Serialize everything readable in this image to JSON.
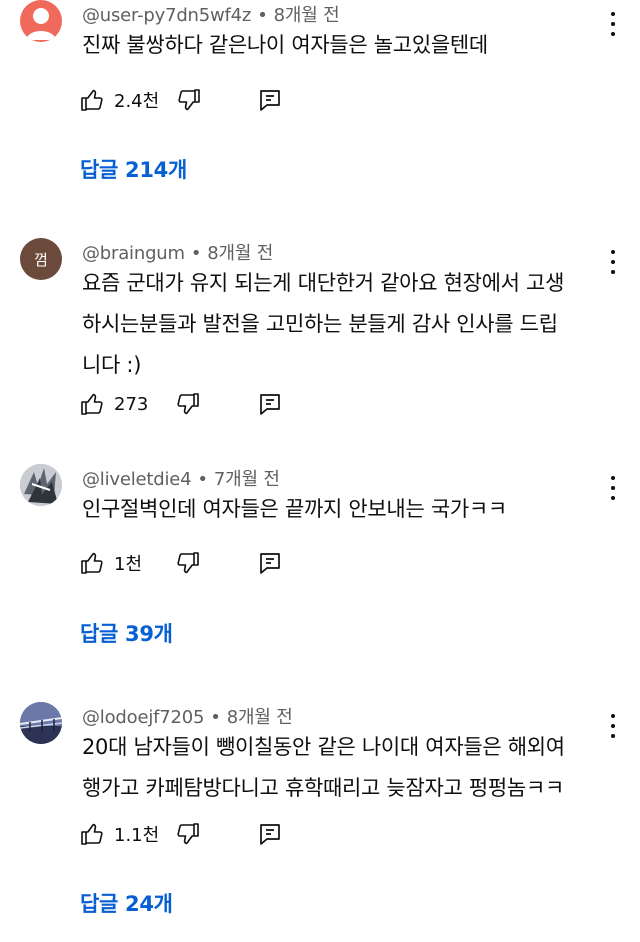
{
  "comments": [
    {
      "author": "@user-py7dn5wf4z",
      "time": "8개월 전",
      "text": "진짜 불쌍하다 같은나이 여자들은 놀고있을텐데",
      "likes": "2.4천",
      "replies_label": "답글 214개",
      "avatar": {
        "icon": "default-user-icon",
        "bg": "#f06a5c"
      }
    },
    {
      "author": "@braingum",
      "time": "8개월 전",
      "text": "요즘 군대가 유지 되는게 대단한거 같아요 현장에서 고생하시는분들과 발전을 고민하는 분들게 감사 인사를 드립니다 :)",
      "likes": "273",
      "avatar": {
        "letter": "껌",
        "bg": "#6b4a3c"
      }
    },
    {
      "author": "@liveletdie4",
      "time": "7개월 전",
      "text": "인구절벽인데 여자들은 끝까지 안보내는 국가ㅋㅋ",
      "likes": "1천",
      "replies_label": "답글 39개",
      "avatar": {
        "icon": "anime-avatar-icon",
        "bg": "#9aa0a6"
      }
    },
    {
      "author": "@lodoejf7205",
      "time": "8개월 전",
      "text": "20대 남자들이 뺑이칠동안 같은 나이대 여자들은 해외여행가고 카페탐방다니고 휴학때리고 늦잠자고 펑펑놈ㅋㅋ",
      "likes": "1.1천",
      "replies_label": "답글 24개",
      "avatar": {
        "icon": "bridge-photo-icon",
        "bg": "#4a5a8a"
      }
    }
  ],
  "icons": {
    "like": "thumbs-up-icon",
    "dislike": "thumbs-down-icon",
    "reply": "reply-comment-icon",
    "menu": "more-vert-icon"
  },
  "colors": {
    "link_blue": "#065fd4",
    "meta_gray": "#606060",
    "text": "#0f0f0f"
  }
}
